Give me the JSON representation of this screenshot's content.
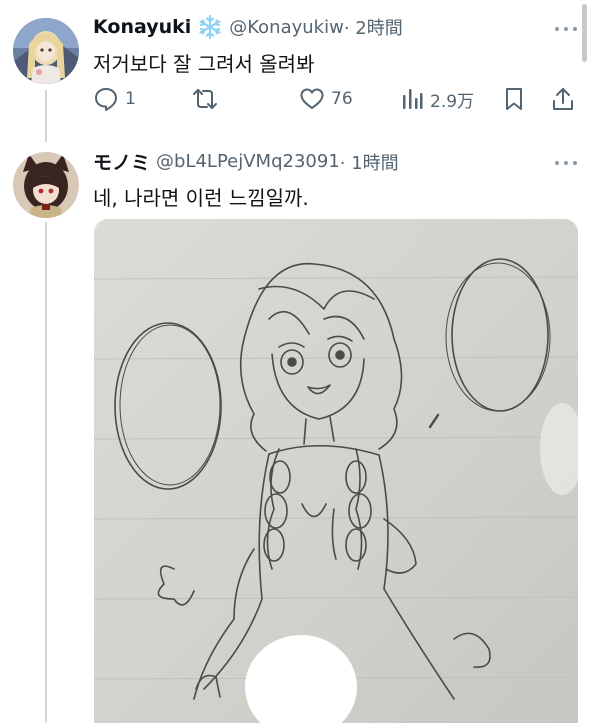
{
  "tweet1": {
    "name": "Konayuki",
    "handle": "@Konayukiw",
    "time": "· 2時間",
    "text": "저거보다 잘 그려서 올려봐",
    "stats": {
      "replies": "1",
      "reposts": "",
      "likes": "76",
      "views": "2.9万"
    }
  },
  "tweet2": {
    "name": "モノミ",
    "handle": "@bL4LPejVMq23091",
    "time": "· 1時間",
    "text": "네, 나라면 이런 느낌일까."
  },
  "icons": {
    "verified": "snowflake-icon",
    "reply": "reply-icon",
    "repost": "repost-icon",
    "like": "heart-icon",
    "views": "views-icon",
    "bookmark": "bookmark-icon",
    "share": "share-icon",
    "more": "more-icon"
  },
  "colors": {
    "text_primary": "#0f1419",
    "text_secondary": "#536471",
    "thread_line": "#cfd9de",
    "verified": "#8fd3f4"
  }
}
